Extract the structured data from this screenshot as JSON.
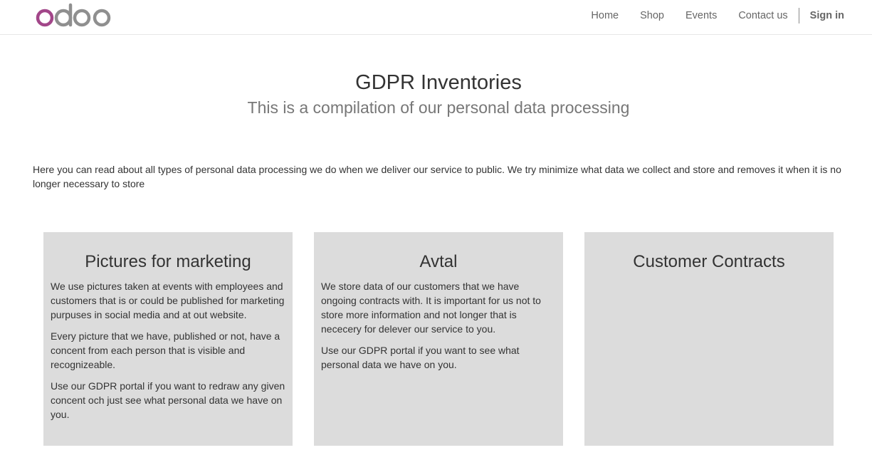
{
  "brand": {
    "logo_text": "odoo",
    "colors": {
      "logo_o": "#a24689",
      "logo_rest": "#8f8f8f",
      "card_bg": "#dcdcdc"
    }
  },
  "nav": {
    "items": [
      {
        "label": "Home"
      },
      {
        "label": "Shop"
      },
      {
        "label": "Events"
      },
      {
        "label": "Contact us"
      }
    ],
    "sign_in": "Sign in"
  },
  "hero": {
    "title": "GDPR Inventories",
    "subtitle": "This is a compilation of our personal data processing"
  },
  "intro": "Here you can read about all types of personal data processing we do when we deliver our service to public. We try minimize what data we collect and store and removes it when it is no longer necessary to store",
  "cards": [
    {
      "title": "Pictures for marketing",
      "paragraphs": [
        "We use pictures taken at events with employees and customers that is or could be published for marketing purpuses in social media and at out website.",
        "Every picture that we have, published or not, have a concent from each person that is visible and recognizeable.",
        "Use our GDPR portal if you want to redraw any given concent och just see what personal data we have on you."
      ]
    },
    {
      "title": "Avtal",
      "paragraphs": [
        "We store data of our customers that we have ongoing contracts with. It is important for us not to store more information and not longer that is nececery for delever our service to you.",
        "Use our GDPR portal if you want to see what personal data we have on you."
      ]
    },
    {
      "title": "Customer Contracts",
      "paragraphs": []
    }
  ]
}
